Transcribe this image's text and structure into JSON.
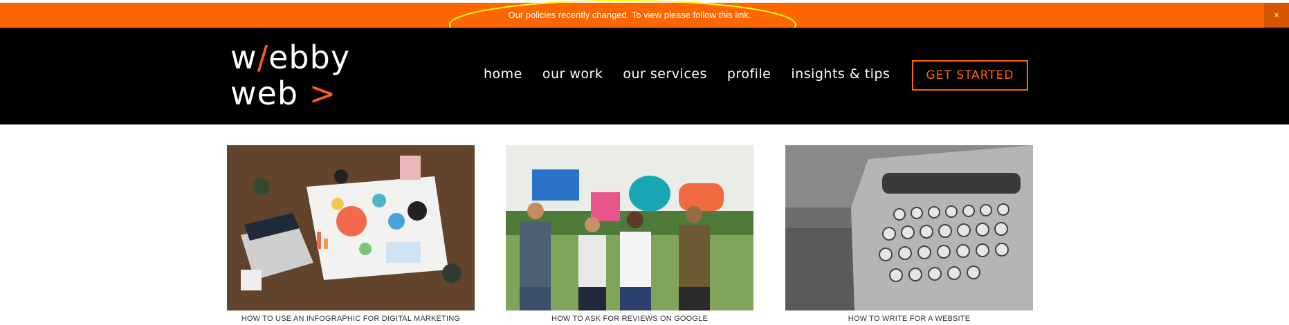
{
  "notice": {
    "text": "Our policies recently changed. To view please follow this link.",
    "close_label": "×",
    "bar_color": "#ff6600",
    "annotation_color": "#ffff00"
  },
  "logo": {
    "line1_pre": "w",
    "line1_mark": "/",
    "line1_post": "ebby",
    "line2_text": "web",
    "line2_mark": ">"
  },
  "nav": {
    "items": [
      "home",
      "our work",
      "our services",
      "profile",
      "insights & tips"
    ]
  },
  "cta": {
    "label": "GET STARTED"
  },
  "cards": [
    {
      "caption": "HOW TO USE AN INFOGRAPHIC FOR DIGITAL MARKETING"
    },
    {
      "caption": "HOW TO ASK FOR REVIEWS ON GOOGLE"
    },
    {
      "caption": "HOW TO WRITE FOR A WEBSITE"
    }
  ],
  "colors": {
    "accent": "#ff6600",
    "header_bg": "#000000"
  }
}
